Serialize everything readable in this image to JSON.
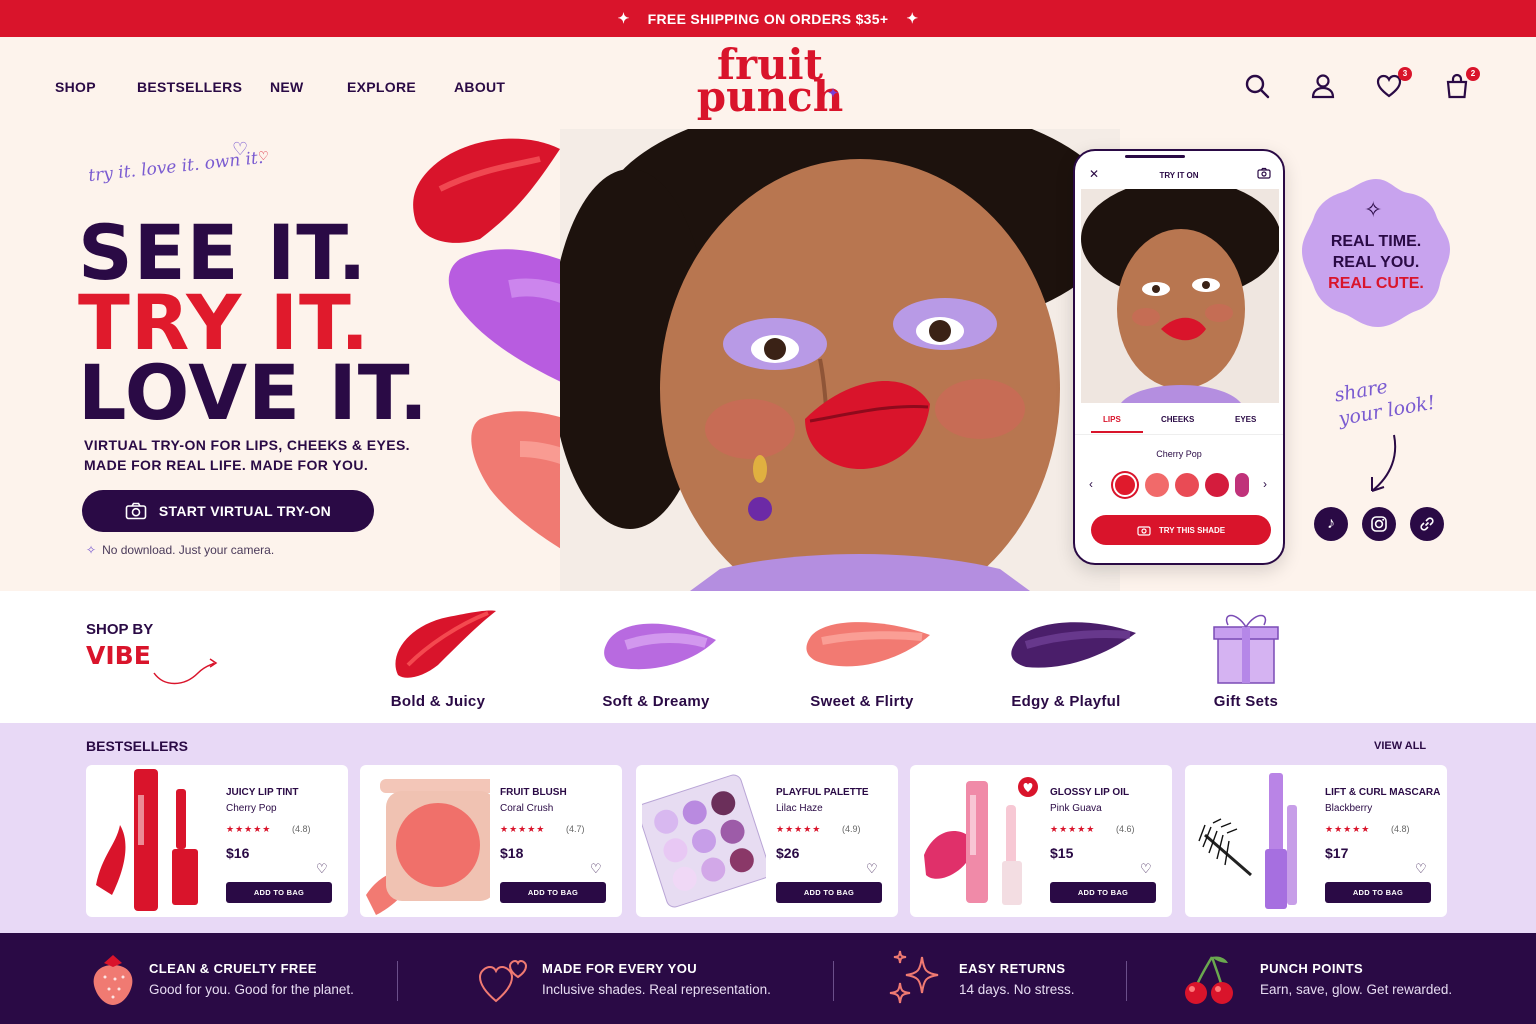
{
  "promo": {
    "text": "FREE SHIPPING ON ORDERS $35+",
    "star": "✦"
  },
  "nav": {
    "items": [
      "SHOP",
      "BESTSELLERS",
      "NEW",
      "EXPLORE",
      "ABOUT"
    ],
    "logo_line1": "fruit",
    "logo_line2": "punch",
    "wishlist_count": "3",
    "cart_count": "2"
  },
  "hero": {
    "tagline": "try it. love it. own it.",
    "headline": [
      "SEE IT.",
      "TRY IT.",
      "LOVE IT."
    ],
    "sub1": "VIRTUAL TRY-ON FOR LIPS, CHEEKS & EYES.",
    "sub2": "MADE FOR REAL LIFE. MADE FOR YOU.",
    "cta": "START VIRTUAL TRY-ON",
    "note": "No download. Just your camera."
  },
  "tryon": {
    "title": "TRY IT ON",
    "tabs": [
      "LIPS",
      "CHEEKS",
      "EYES"
    ],
    "active_tab": "LIPS",
    "shade_name": "Cherry Pop",
    "swatches": [
      "#e01a2c",
      "#f16a6a",
      "#e94b55",
      "#d41c3d",
      "#c0327a"
    ],
    "button": "TRY THIS SHADE"
  },
  "badge": {
    "line1": "REAL TIME.",
    "line2": "REAL YOU.",
    "line3": "REAL CUTE."
  },
  "share": {
    "line1": "share",
    "line2": "your look!"
  },
  "vibe": {
    "label1": "SHOP BY",
    "label2": "VIBE",
    "categories": [
      "Bold & Juicy",
      "Soft & Dreamy",
      "Sweet & Flirty",
      "Edgy & Playful",
      "Gift Sets"
    ]
  },
  "bestsellers": {
    "title": "BESTSELLERS",
    "view_all": "VIEW ALL",
    "add_label": "ADD TO BAG",
    "products": [
      {
        "name": "JUICY LIP TINT",
        "shade": "Cherry Pop",
        "stars": "★★★★★",
        "rating": "(4.8)",
        "price": "$16"
      },
      {
        "name": "FRUIT BLUSH",
        "shade": "Coral Crush",
        "stars": "★★★★★",
        "rating": "(4.7)",
        "price": "$18"
      },
      {
        "name": "PLAYFUL PALETTE",
        "shade": "Lilac Haze",
        "stars": "★★★★★",
        "rating": "(4.9)",
        "price": "$26"
      },
      {
        "name": "GLOSSY LIP OIL",
        "shade": "Pink Guava",
        "stars": "★★★★★",
        "rating": "(4.6)",
        "price": "$15"
      },
      {
        "name": "LIFT & CURL MASCARA",
        "shade": "Blackberry",
        "stars": "★★★★★",
        "rating": "(4.8)",
        "price": "$17"
      }
    ]
  },
  "features": [
    {
      "title": "CLEAN & CRUELTY FREE",
      "sub": "Good for you. Good for the planet."
    },
    {
      "title": "MADE FOR EVERY YOU",
      "sub": "Inclusive shades. Real representation."
    },
    {
      "title": "EASY RETURNS",
      "sub": "14 days. No stress."
    },
    {
      "title": "PUNCH POINTS",
      "sub": "Earn, save, glow. Get rewarded."
    }
  ],
  "colors": {
    "red": "#d9142b",
    "plum": "#2a0a45",
    "lilac": "#c8a3ee",
    "cream": "#fdf3ec",
    "lavender_bg": "#e8d9f6"
  }
}
